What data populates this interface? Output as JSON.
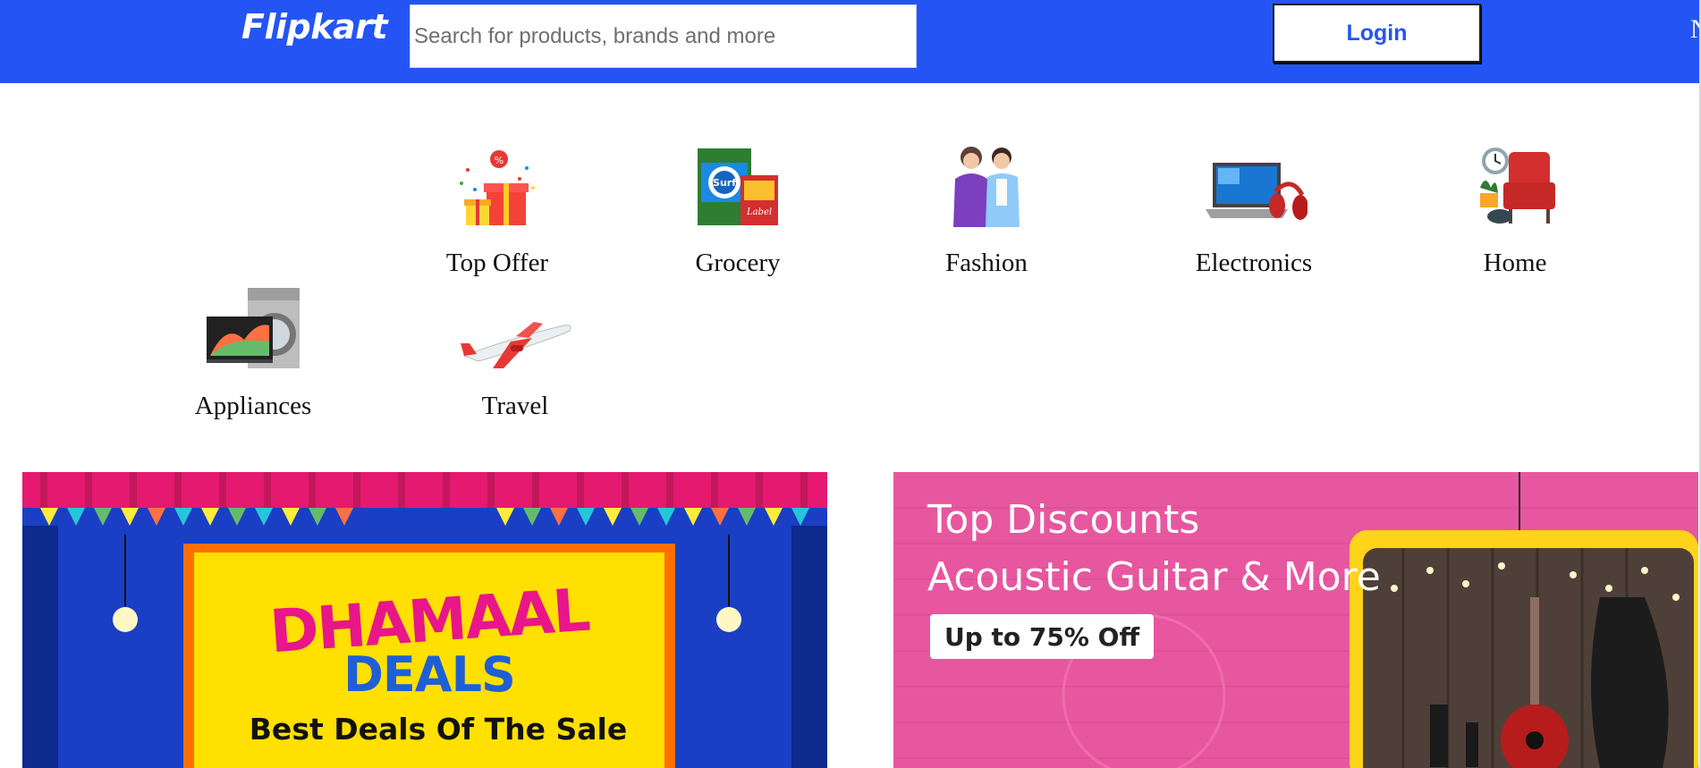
{
  "header": {
    "logo": "Flipkart",
    "search_placeholder": "Search for products, brands and more",
    "login_label": "Login",
    "edge_text": "N"
  },
  "categories": [
    {
      "label": "Top Offer",
      "icon": "gift-offer-icon"
    },
    {
      "label": "Grocery",
      "icon": "grocery-icon"
    },
    {
      "label": "Fashion",
      "icon": "fashion-icon"
    },
    {
      "label": "Electronics",
      "icon": "electronics-icon"
    },
    {
      "label": "Home",
      "icon": "home-furniture-icon"
    },
    {
      "label": "Appliances",
      "icon": "appliances-icon"
    },
    {
      "label": "Travel",
      "icon": "airplane-icon"
    }
  ],
  "banners": {
    "left": {
      "title_line1": "DHAMAAL",
      "title_line2": "DEALS",
      "subtitle": "Best Deals Of The Sale"
    },
    "right": {
      "line1": "Top Discounts",
      "line2": "Acoustic Guitar & More",
      "badge": "Up to 75% Off"
    }
  },
  "colors": {
    "header_bg": "#2455f4",
    "login_text": "#2455f4",
    "banner_left_bg": "#1f44c9",
    "banner_right_bg": "#e7579f",
    "deal_pink": "#e8168a",
    "deal_blue": "#1f5fd6"
  }
}
